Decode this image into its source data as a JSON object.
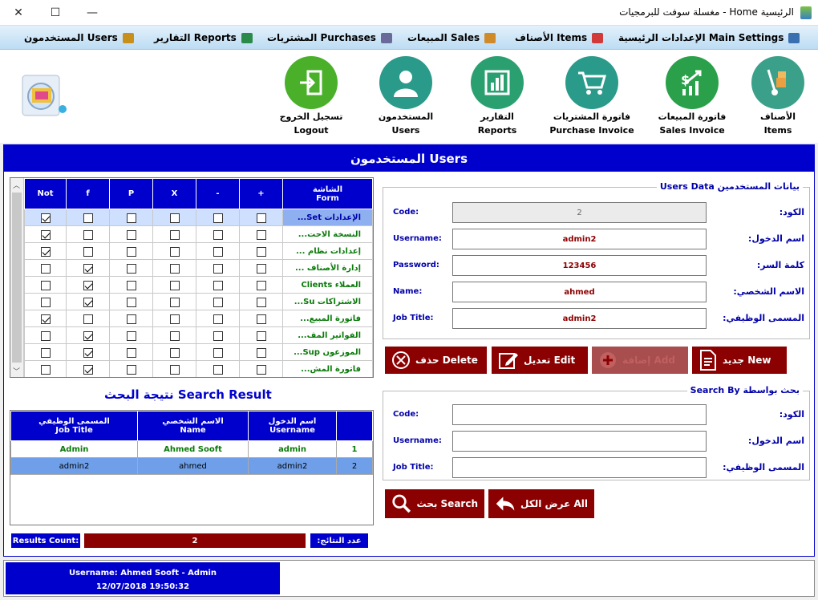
{
  "window": {
    "title": "الرئيسية Home - مغسلة سوفت للبرمجيات",
    "minimize": "—",
    "maximize": "☐",
    "close": "✕"
  },
  "menu": [
    {
      "label": "الإعدادات الرئيسية Main Settings",
      "icon": "gears-icon",
      "color": "#3a6fb0"
    },
    {
      "label": "الأصناف Items",
      "icon": "cart-icon",
      "color": "#d23a3a"
    },
    {
      "label": "المبيعات Sales",
      "icon": "box-icon",
      "color": "#d08a2a"
    },
    {
      "label": "المشتريات Purchases",
      "icon": "truck-icon",
      "color": "#6a6a9a"
    },
    {
      "label": "التقارير Reports",
      "icon": "bar-chart-icon",
      "color": "#2a8a4a"
    },
    {
      "label": "المستخدمون Users",
      "icon": "users-icon",
      "color": "#c8901a"
    }
  ],
  "toolbar": [
    {
      "ar": "الأصناف",
      "en": "Items",
      "icon": "hand-truck-icon",
      "color": "#3aa08a"
    },
    {
      "ar": "فاتورة المبيعات",
      "en": "Sales Invoice",
      "icon": "growth-chart-icon",
      "color": "#2aa04a"
    },
    {
      "ar": "فاتورة المشتريات",
      "en": "Purchase Invoice",
      "icon": "shopping-cart-icon",
      "color": "#2a9a8a"
    },
    {
      "ar": "التقارير",
      "en": "Reports",
      "icon": "report-chart-icon",
      "color": "#2aa070"
    },
    {
      "ar": "المستخدمون",
      "en": "Users",
      "icon": "user-icon",
      "color": "#2a9a8a"
    },
    {
      "ar": "تسجيل الخروج",
      "en": "Logout",
      "icon": "logout-icon",
      "color": "#4ab02a"
    }
  ],
  "main": {
    "header": "المستخدمون Users"
  },
  "permissions": {
    "columns": [
      "Not",
      "f",
      "P",
      "X",
      "-",
      "+"
    ],
    "form_header_ar": "الشاشة",
    "form_header_en": "Form",
    "rows": [
      {
        "form": "الإعدادات Set...",
        "checks": [
          true,
          false,
          false,
          false,
          false,
          false
        ],
        "selected": true
      },
      {
        "form": "النسخة الاحت...",
        "checks": [
          true,
          false,
          false,
          false,
          false,
          false
        ]
      },
      {
        "form": "إعدادات نظام ...",
        "checks": [
          true,
          false,
          false,
          false,
          false,
          false
        ]
      },
      {
        "form": "إدارة الأصناف ...",
        "checks": [
          false,
          true,
          false,
          false,
          false,
          false
        ]
      },
      {
        "form": "العملاء Clients",
        "checks": [
          false,
          true,
          false,
          false,
          false,
          false
        ]
      },
      {
        "form": "الاشتراكات Su...",
        "checks": [
          false,
          true,
          false,
          false,
          false,
          false
        ]
      },
      {
        "form": "فاتورة المبيع...",
        "checks": [
          true,
          false,
          false,
          false,
          false,
          false
        ]
      },
      {
        "form": "الفواتير المف...",
        "checks": [
          false,
          true,
          false,
          false,
          false,
          false
        ]
      },
      {
        "form": "الموزعون Sup...",
        "checks": [
          false,
          true,
          false,
          false,
          false,
          false
        ]
      },
      {
        "form": "فاتورة المش...",
        "checks": [
          false,
          true,
          false,
          false,
          false,
          false
        ]
      }
    ]
  },
  "search_result": {
    "title": "نتيجة البحث Search Result",
    "headers": [
      {
        "ar": "المسمى الوظيفي",
        "en": "Job Title"
      },
      {
        "ar": "الاسم الشخصي",
        "en": "Name"
      },
      {
        "ar": "اسم الدخول",
        "en": "Username"
      },
      {
        "ar": "",
        "en": ""
      }
    ],
    "rows": [
      {
        "job": "Admin",
        "name": "Ahmed Sooft",
        "username": "admin",
        "num": "1"
      },
      {
        "job": "admin2",
        "name": "ahmed",
        "username": "admin2",
        "num": "2",
        "selected": true
      }
    ]
  },
  "results_count": {
    "label_en": "Results Count:",
    "value": "2",
    "label_ar": "عدد النتائج:"
  },
  "user_data": {
    "legend": "بيانات المستخدمين Users Data",
    "fields": [
      {
        "en": "Code:",
        "ar": "الكود:",
        "value": "2",
        "readonly": true
      },
      {
        "en": "Username:",
        "ar": "اسم الدخول:",
        "value": "admin2"
      },
      {
        "en": "Password:",
        "ar": "كلمة السر:",
        "value": "123456"
      },
      {
        "en": "Name:",
        "ar": "الاسم الشخصي:",
        "value": "ahmed"
      },
      {
        "en": "Job Title:",
        "ar": "المسمى الوظيفي:",
        "value": "admin2"
      }
    ]
  },
  "actions": {
    "delete": "حذف Delete",
    "edit": "تعديل Edit",
    "add": "إضافة Add",
    "new": "جديد New"
  },
  "search_by": {
    "legend": "بحث بواسطة Search By",
    "fields": [
      {
        "en": "Code:",
        "ar": "الكود:",
        "value": ""
      },
      {
        "en": "Username:",
        "ar": "اسم الدخول:",
        "value": ""
      },
      {
        "en": "Job Title:",
        "ar": "المسمى الوظيفي:",
        "value": ""
      }
    ],
    "search": "بحث Search",
    "show_all": "عرض الكل All"
  },
  "status": {
    "user": "Username: Ahmed Sooft - Admin",
    "datetime": "12/07/2018 19:50:32"
  }
}
